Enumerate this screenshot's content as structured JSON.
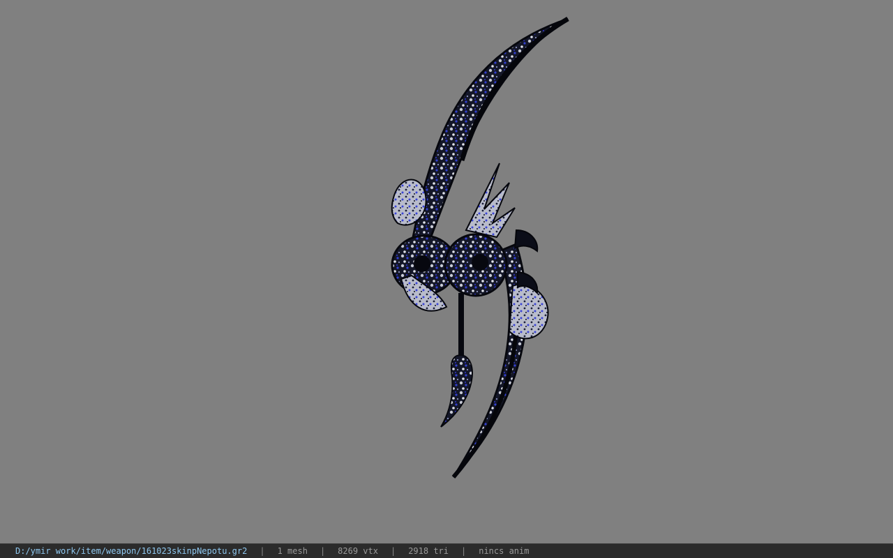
{
  "viewer": {
    "background_color": "#808080",
    "model_colors": {
      "dark": "#0d0f1c",
      "metal": "#c9ccd8",
      "accent": "#2c37c9"
    }
  },
  "status_bar": {
    "file_path": "D:/ymir work/item/weapon/161023skinpNepotu.gr2",
    "separator": "|",
    "mesh_count": "1 mesh",
    "vertex_count": "8269 vtx",
    "triangle_count": "2918 tri",
    "animation": "nincs anim"
  }
}
